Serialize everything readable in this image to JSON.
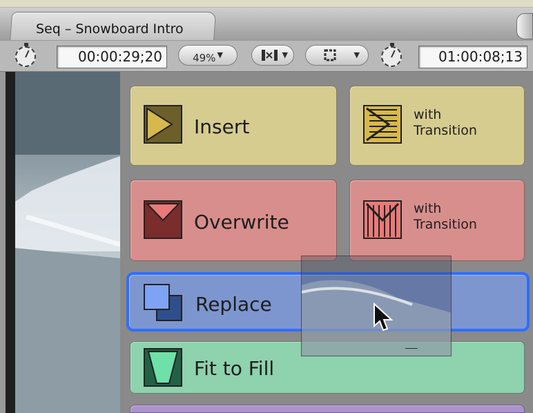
{
  "sequence_tab": {
    "label": "Seq – Snowboard Intro"
  },
  "toolbar": {
    "current_timecode": "00:00:29;20",
    "zoom": "49%",
    "view_options_icon": "view-options-icon",
    "overlay_options_icon": "overlay-options-icon",
    "duration_timecode": "01:00:08;13"
  },
  "overlay": {
    "insert_label": "Insert",
    "insert_with_transition_line1": "with",
    "insert_with_transition_line2": "Transition",
    "overwrite_label": "Overwrite",
    "overwrite_with_transition_line1": "with",
    "overwrite_with_transition_line2": "Transition",
    "replace_label": "Replace",
    "fit_to_fill_label": "Fit to Fill"
  },
  "colors": {
    "insert": "#d6cc8f",
    "overwrite": "#d88e8c",
    "replace": "#7d96cf",
    "replace_highlight": "#2f6fff",
    "fit_to_fill": "#8ed2ae",
    "superimpose": "#aa92cc"
  }
}
